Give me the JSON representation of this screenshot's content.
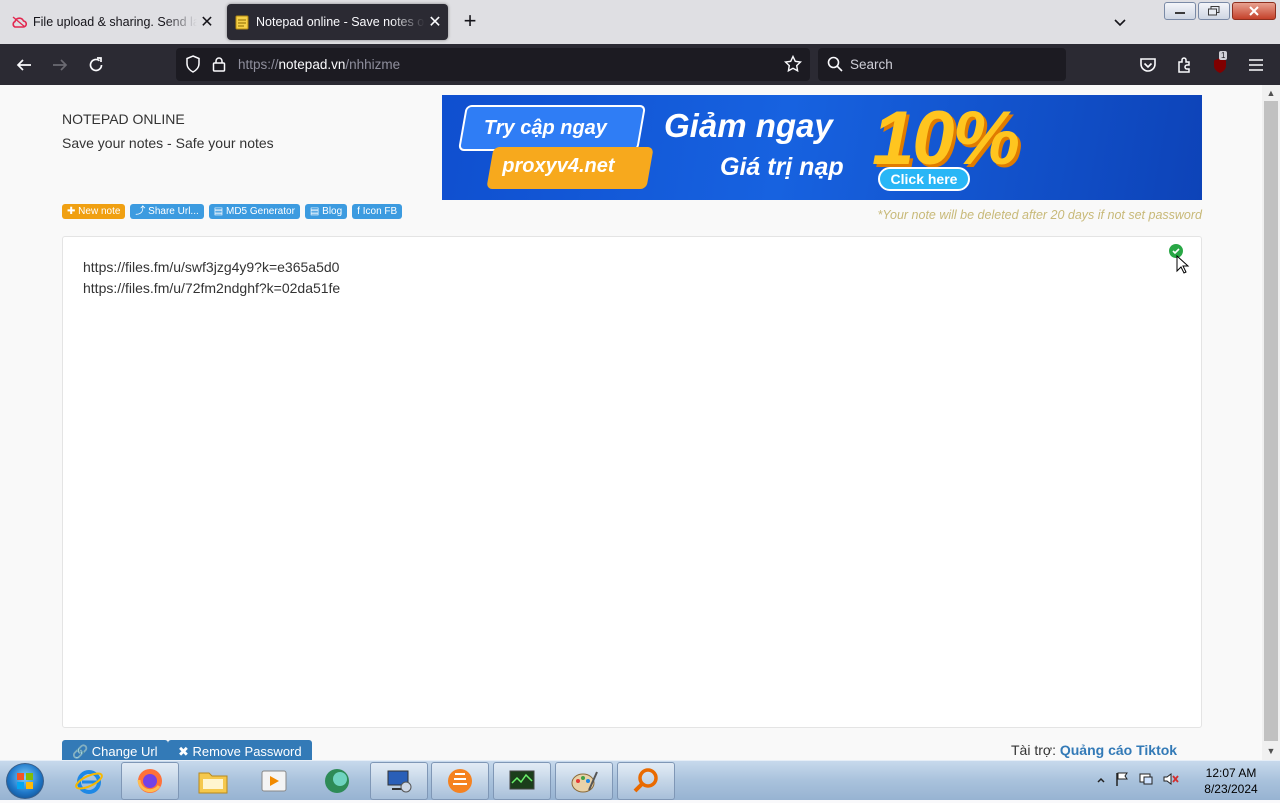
{
  "browser": {
    "tabs": [
      {
        "title": "File upload & sharing. Send large files",
        "active": false,
        "close": "✕"
      },
      {
        "title": "Notepad online - Save notes online",
        "active": true,
        "close": "✕"
      }
    ],
    "new_tab": "+",
    "url_prefix": "https://",
    "url_host": "notepad.vn",
    "url_path": "/nhhizme",
    "search_placeholder": "Search",
    "extension_badge": "1"
  },
  "site": {
    "title": "NOTEPAD ONLINE",
    "subtitle": "Save your notes - Safe your notes",
    "banner": {
      "tag1": "Try cập ngay",
      "tag2": "proxyv4.net",
      "headline": "Giảm ngay",
      "subline": "Giá trị nạp",
      "percent": "10%",
      "cta": "Click here"
    },
    "buttons": [
      {
        "label": "✚ New note",
        "color": "orange"
      },
      {
        "label": "⤴ Share Url...",
        "color": "blue"
      },
      {
        "label": "▤ MD5 Generator",
        "color": "blue"
      },
      {
        "label": "▤ Blog",
        "color": "blue"
      },
      {
        "label": "f Icon FB",
        "color": "blue"
      }
    ],
    "warning": "*Your note will be deleted after 20 days if not set password",
    "note_lines": [
      "https://files.fm/u/swf3jzg4y9?k=e365a5d0",
      "https://files.fm/u/72fm2ndghf?k=02da51fe"
    ],
    "change_url": "🔗 Change Url",
    "remove_password": "✖ Remove Password",
    "sponsor_label": "Tài trợ:",
    "sponsor_link": "Quảng cáo Tiktok"
  },
  "taskbar": {
    "time": "12:07 AM",
    "date": "8/23/2024",
    "apps": [
      "internet-explorer",
      "firefox",
      "file-explorer",
      "media-player",
      "app-green",
      "network-app",
      "vlc",
      "task-monitor",
      "paint",
      "search-app"
    ]
  },
  "colors": {
    "accent_blue": "#337ab7",
    "orange": "#f0a012",
    "tab_active": "#2b2a33",
    "warning_text": "#c8b978"
  }
}
